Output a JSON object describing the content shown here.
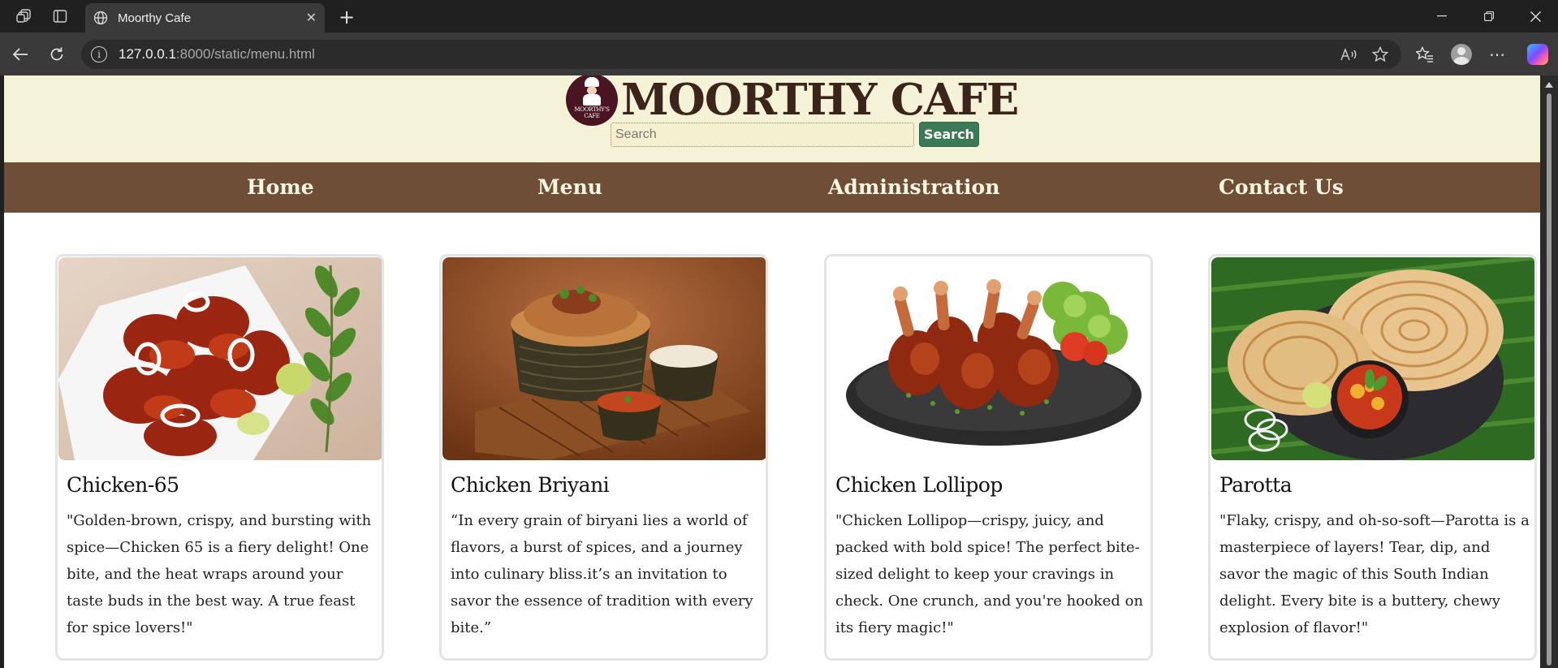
{
  "browser": {
    "tab_title": "Moorthy Cafe",
    "url_host": "127.0.0.1",
    "url_rest": ":8000/static/menu.html",
    "icons": [
      "workspaces-icon",
      "tab-actions-icon",
      "globe-icon",
      "close-icon",
      "new-tab-icon",
      "minimize-icon",
      "restore-icon",
      "window-close-icon",
      "back-icon",
      "reload-icon",
      "info-icon",
      "read-aloud-icon",
      "favorite-star-icon",
      "favorites-icon",
      "profile-icon",
      "more-icon",
      "copilot-icon"
    ]
  },
  "header": {
    "logo_text": "MOORTHY'S CAFE",
    "site_title": "MOORTHY CAFE",
    "search_placeholder": "Search",
    "search_button": "Search"
  },
  "nav": {
    "home": "Home",
    "menu": "Menu",
    "administration": "Administration",
    "contact": "Contact Us"
  },
  "items": [
    {
      "name": "Chicken-65",
      "description": "\"Golden-brown, crispy, and bursting with spice—Chicken 65 is a fiery delight! One bite, and the heat wraps around your taste buds in the best way. A true feast for spice lovers!\""
    },
    {
      "name": "Chicken Briyani",
      "description": "“In every grain of biryani lies a world of flavors, a burst of spices, and a journey into culinary bliss.it’s an invitation to savor the essence of tradition with every bite.”"
    },
    {
      "name": "Chicken Lollipop",
      "description": "\"Chicken Lollipop—crispy, juicy, and packed with bold spice! The perfect bite-sized delight to keep your cravings in check. One crunch, and you're hooked on its fiery magic!\""
    },
    {
      "name": "Parotta",
      "description": "\"Flaky, crispy, and oh-so-soft—Parotta is a masterpiece of layers! Tear, dip, and savor the magic of this South Indian delight. Every bite is a buttery, chewy explosion of flavor!\""
    }
  ],
  "colors": {
    "header_bg": "#f5f3d7",
    "nav_bg": "#6f4e37",
    "title_color": "#3b2419",
    "search_button_bg": "#3c7a55"
  }
}
